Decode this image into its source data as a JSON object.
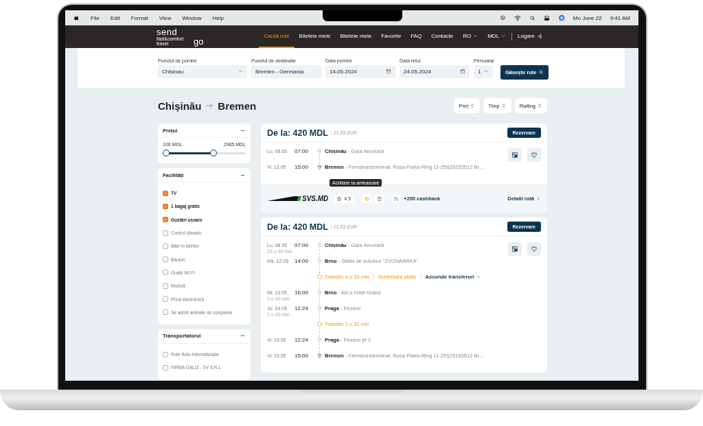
{
  "menu_bar": {
    "menus": [
      "File",
      "Edit",
      "Format",
      "View",
      "Window",
      "Help"
    ],
    "date": "Mo June 22",
    "time": "9:41 AM"
  },
  "nav": {
    "logo": {
      "top": "send",
      "bottom": "go",
      "tagline": "fast&comfort travel"
    },
    "links": [
      {
        "label": "Caută rute",
        "selected": true
      },
      {
        "label": "Biletele mele",
        "selected": false
      },
      {
        "label": "Biletele mele",
        "selected": false
      },
      {
        "label": "Favorite",
        "selected": false
      },
      {
        "label": "FAQ",
        "selected": false
      },
      {
        "label": "Contacte",
        "selected": false
      }
    ],
    "language": "RO",
    "currency": "MDL",
    "login": "Logare"
  },
  "search": {
    "fields": [
      {
        "label": "Punctul de pornire",
        "value": "Chisinau",
        "kind": "select"
      },
      {
        "label": "Punctul de destinatie",
        "value": "Bremen - Germania",
        "kind": "text"
      },
      {
        "label": "Data pornire",
        "value": "14.05.2024",
        "kind": "date"
      },
      {
        "label": "Data retur",
        "value": "24.05.2024",
        "kind": "date"
      },
      {
        "label": "Persoane",
        "value": "1",
        "kind": "count"
      }
    ],
    "button": "Găsește rute"
  },
  "title": {
    "from": "Chișinău",
    "to": "Bremen"
  },
  "sort_buttons": [
    "Preț",
    "Timp",
    "Raiting"
  ],
  "filters": [
    {
      "title": "Prețul",
      "kind": "range",
      "min": "100 MDL",
      "max": "2985 MDL",
      "low": {
        "level": 0
      },
      "high": {
        "level": 0.62
      }
    },
    {
      "title": "Facilități",
      "kind": "checklist",
      "items": [
        {
          "label": "TV",
          "checked": true
        },
        {
          "label": "1 bagaj gratis",
          "checked": true
        },
        {
          "label": "Gustări ușoare",
          "checked": true
        },
        {
          "label": "Control climatic",
          "checked": false
        },
        {
          "label": "Bilet în telefon",
          "checked": false
        },
        {
          "label": "Băuturi",
          "checked": false
        },
        {
          "label": "Gratis WI-FI",
          "checked": false
        },
        {
          "label": "Muzică",
          "checked": false
        },
        {
          "label": "Priză electronică",
          "checked": false
        },
        {
          "label": "Se admit animale de companie",
          "checked": false
        }
      ]
    },
    {
      "title": "Transportatorul",
      "kind": "checklist",
      "items": [
        {
          "label": "Rute Auto Internaționale",
          "checked": false
        },
        {
          "label": "FIRMA GALIZ - SV S.R.L",
          "checked": false
        }
      ]
    }
  ],
  "cards": [
    {
      "price": "De la: 420 MDL",
      "price_alt": "21,63 EUR",
      "button": "Rezervare",
      "stops": [
        {
          "kind": "stop",
          "day": "Lu. 08.05",
          "time": "07:00",
          "location": "**Chișinău** - Gara feroviară",
          "final": false
        },
        {
          "kind": "stop",
          "day": "Vi. 12.05",
          "time": "15:00",
          "location": "**Bremen** - Fernsbursterminal, Rosa-Parks-Ring 11-25Ş25152512 Br...",
          "final": true
        }
      ],
      "footer": {
        "carrier": "SVS.MD",
        "rating": "4.5",
        "tooltip": "Achitare la ambarcare",
        "cashback": "+200 cashback",
        "details": "Detalii rută"
      }
    },
    {
      "price": "De la: 420 MDL",
      "price_alt": "21,63 EUR",
      "button": "Rezervare",
      "stops": [
        {
          "kind": "stop",
          "day": "Lu. 08.05",
          "duration": "23 o 40 min",
          "time": "07:00",
          "location": "**Chișinău** - Gara feroviară",
          "final": false
        },
        {
          "kind": "stop",
          "day": "Ma. 12.05",
          "time": "14:00",
          "location": "**Brno** - Statia de autobuz \"ZVONAARKA\"",
          "final": false
        },
        {
          "kind": "transfer",
          "text": "Transfer 4 o 30 min",
          "links": [
            {
              "label": "Schimbare statie",
              "kind": "warning"
            },
            {
              "label": "Ascunde transferuri",
              "kind": "toggle",
              "expanded": true
            }
          ]
        },
        {
          "kind": "stop",
          "day": "Mi. 13.05",
          "duration": "2 o 40 min",
          "time": "16:00",
          "location": "**Brno** - AN u hotel Grand",
          "final": false
        },
        {
          "kind": "stop",
          "day": "Jo. 14.05",
          "duration": "2 o 40 min",
          "time": "12:24",
          "location": "**Praga** - Florenc",
          "final": false
        },
        {
          "kind": "transfer",
          "text": "Transfer 2 o 32 min"
        },
        {
          "kind": "stop",
          "day": "Vi. 15.05",
          "time": "12:24",
          "location": "**Praga** - Florenc pt 2",
          "final": false
        },
        {
          "kind": "stop",
          "day": "Vi. 15.05",
          "time": "15:00",
          "location": "**Bremen** - Fernsbursterminal, Rosa-Parks-Ring 11-25Ş25152512 Br...",
          "final": true
        }
      ]
    }
  ]
}
